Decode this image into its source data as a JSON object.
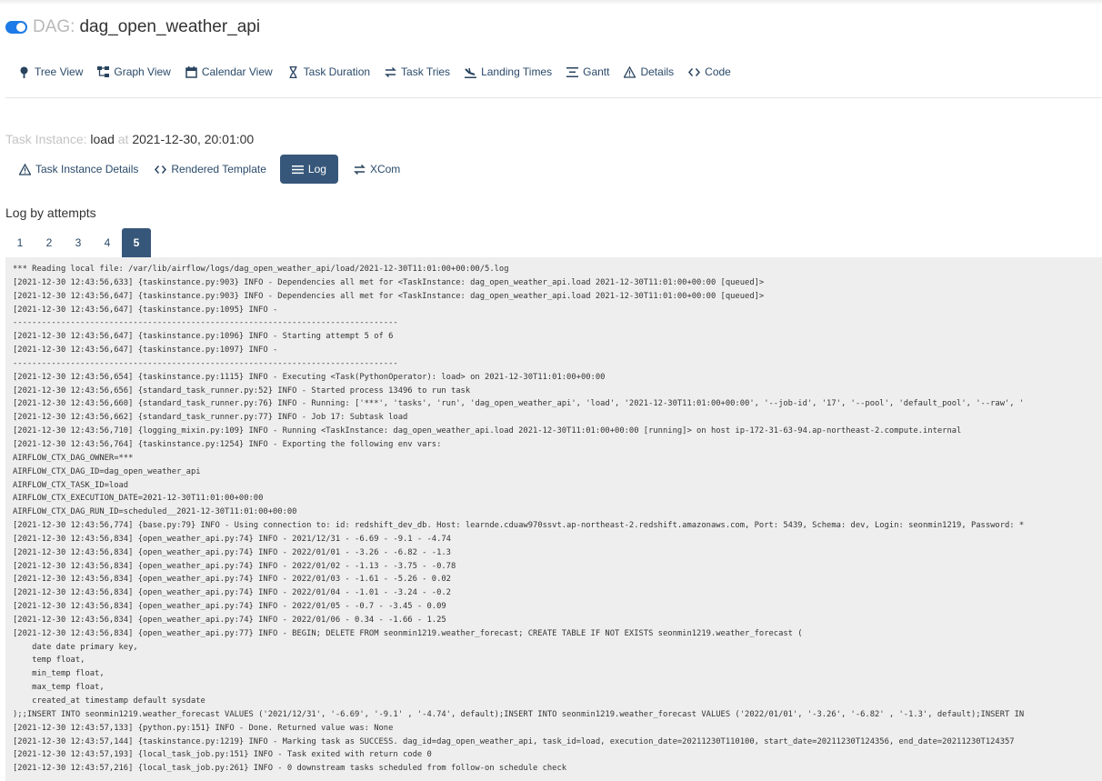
{
  "dag": {
    "toggle_state": "on",
    "prefix": "DAG:",
    "id": "dag_open_weather_api"
  },
  "nav": {
    "items": [
      {
        "label": "Tree View",
        "icon": "tree-icon"
      },
      {
        "label": "Graph View",
        "icon": "graph-icon"
      },
      {
        "label": "Calendar View",
        "icon": "calendar-icon"
      },
      {
        "label": "Task Duration",
        "icon": "hourglass-icon"
      },
      {
        "label": "Task Tries",
        "icon": "retry-icon"
      },
      {
        "label": "Landing Times",
        "icon": "landing-icon"
      },
      {
        "label": "Gantt",
        "icon": "gantt-icon"
      },
      {
        "label": "Details",
        "icon": "warning-icon"
      },
      {
        "label": "Code",
        "icon": "code-icon"
      }
    ]
  },
  "task_instance": {
    "prefix": "Task Instance:",
    "task": "load",
    "at_label": "at",
    "execution_date": "2021-12-30, 20:01:00"
  },
  "tabs": {
    "items": [
      {
        "label": "Task Instance Details",
        "icon": "warning-icon",
        "active": false
      },
      {
        "label": "Rendered Template",
        "icon": "code-icon",
        "active": false
      },
      {
        "label": "Log",
        "icon": "list-icon",
        "active": true
      },
      {
        "label": "XCom",
        "icon": "exchange-icon",
        "active": false
      }
    ]
  },
  "log": {
    "title": "Log by attempts",
    "attempts": [
      "1",
      "2",
      "3",
      "4",
      "5"
    ],
    "active_attempt": "5",
    "colors": {
      "active": "#37577a",
      "log_bg": "#eeeeee"
    },
    "lines": [
      "*** Reading local file: /var/lib/airflow/logs/dag_open_weather_api/load/2021-12-30T11:01:00+00:00/5.log",
      "[2021-12-30 12:43:56,633] {taskinstance.py:903} INFO - Dependencies all met for <TaskInstance: dag_open_weather_api.load 2021-12-30T11:01:00+00:00 [queued]>",
      "[2021-12-30 12:43:56,647] {taskinstance.py:903} INFO - Dependencies all met for <TaskInstance: dag_open_weather_api.load 2021-12-30T11:01:00+00:00 [queued]>",
      "[2021-12-30 12:43:56,647] {taskinstance.py:1095} INFO -",
      "--------------------------------------------------------------------------------",
      "[2021-12-30 12:43:56,647] {taskinstance.py:1096} INFO - Starting attempt 5 of 6",
      "[2021-12-30 12:43:56,647] {taskinstance.py:1097} INFO -",
      "--------------------------------------------------------------------------------",
      "[2021-12-30 12:43:56,654] {taskinstance.py:1115} INFO - Executing <Task(PythonOperator): load> on 2021-12-30T11:01:00+00:00",
      "[2021-12-30 12:43:56,656] {standard_task_runner.py:52} INFO - Started process 13496 to run task",
      "[2021-12-30 12:43:56,660] {standard_task_runner.py:76} INFO - Running: ['***', 'tasks', 'run', 'dag_open_weather_api', 'load', '2021-12-30T11:01:00+00:00', '--job-id', '17', '--pool', 'default_pool', '--raw', '",
      "[2021-12-30 12:43:56,662] {standard_task_runner.py:77} INFO - Job 17: Subtask load",
      "[2021-12-30 12:43:56,710] {logging_mixin.py:109} INFO - Running <TaskInstance: dag_open_weather_api.load 2021-12-30T11:01:00+00:00 [running]> on host ip-172-31-63-94.ap-northeast-2.compute.internal",
      "[2021-12-30 12:43:56,764] {taskinstance.py:1254} INFO - Exporting the following env vars:",
      "AIRFLOW_CTX_DAG_OWNER=***",
      "AIRFLOW_CTX_DAG_ID=dag_open_weather_api",
      "AIRFLOW_CTX_TASK_ID=load",
      "AIRFLOW_CTX_EXECUTION_DATE=2021-12-30T11:01:00+00:00",
      "AIRFLOW_CTX_DAG_RUN_ID=scheduled__2021-12-30T11:01:00+00:00",
      "[2021-12-30 12:43:56,774] {base.py:79} INFO - Using connection to: id: redshift_dev_db. Host: learnde.cduaw970ssvt.ap-northeast-2.redshift.amazonaws.com, Port: 5439, Schema: dev, Login: seonmin1219, Password: *",
      "[2021-12-30 12:43:56,834] {open_weather_api.py:74} INFO - 2021/12/31 - -6.69 - -9.1 - -4.74",
      "[2021-12-30 12:43:56,834] {open_weather_api.py:74} INFO - 2022/01/01 - -3.26 - -6.82 - -1.3",
      "[2021-12-30 12:43:56,834] {open_weather_api.py:74} INFO - 2022/01/02 - -1.13 - -3.75 - -0.78",
      "[2021-12-30 12:43:56,834] {open_weather_api.py:74} INFO - 2022/01/03 - -1.61 - -5.26 - 0.02",
      "[2021-12-30 12:43:56,834] {open_weather_api.py:74} INFO - 2022/01/04 - -1.01 - -3.24 - -0.2",
      "[2021-12-30 12:43:56,834] {open_weather_api.py:74} INFO - 2022/01/05 - -0.7 - -3.45 - 0.09",
      "[2021-12-30 12:43:56,834] {open_weather_api.py:74} INFO - 2022/01/06 - 0.34 - -1.66 - 1.25",
      "[2021-12-30 12:43:56,834] {open_weather_api.py:77} INFO - BEGIN; DELETE FROM seonmin1219.weather_forecast; CREATE TABLE IF NOT EXISTS seonmin1219.weather_forecast (",
      "    date date primary key,",
      "    temp float,",
      "    min_temp float,",
      "    max_temp float,",
      "    created_at timestamp default sysdate",
      ");;INSERT INTO seonmin1219.weather_forecast VALUES ('2021/12/31', '-6.69', '-9.1' , '-4.74', default);INSERT INTO seonmin1219.weather_forecast VALUES ('2022/01/01', '-3.26', '-6.82' , '-1.3', default);INSERT IN",
      "[2021-12-30 12:43:57,133] {python.py:151} INFO - Done. Returned value was: None",
      "[2021-12-30 12:43:57,144] {taskinstance.py:1219} INFO - Marking task as SUCCESS. dag_id=dag_open_weather_api, task_id=load, execution_date=20211230T110100, start_date=20211230T124356, end_date=20211230T124357",
      "[2021-12-30 12:43:57,193] {local_task_job.py:151} INFO - Task exited with return code 0",
      "[2021-12-30 12:43:57,216] {local_task_job.py:261} INFO - 0 downstream tasks scheduled from follow-on schedule check"
    ]
  }
}
